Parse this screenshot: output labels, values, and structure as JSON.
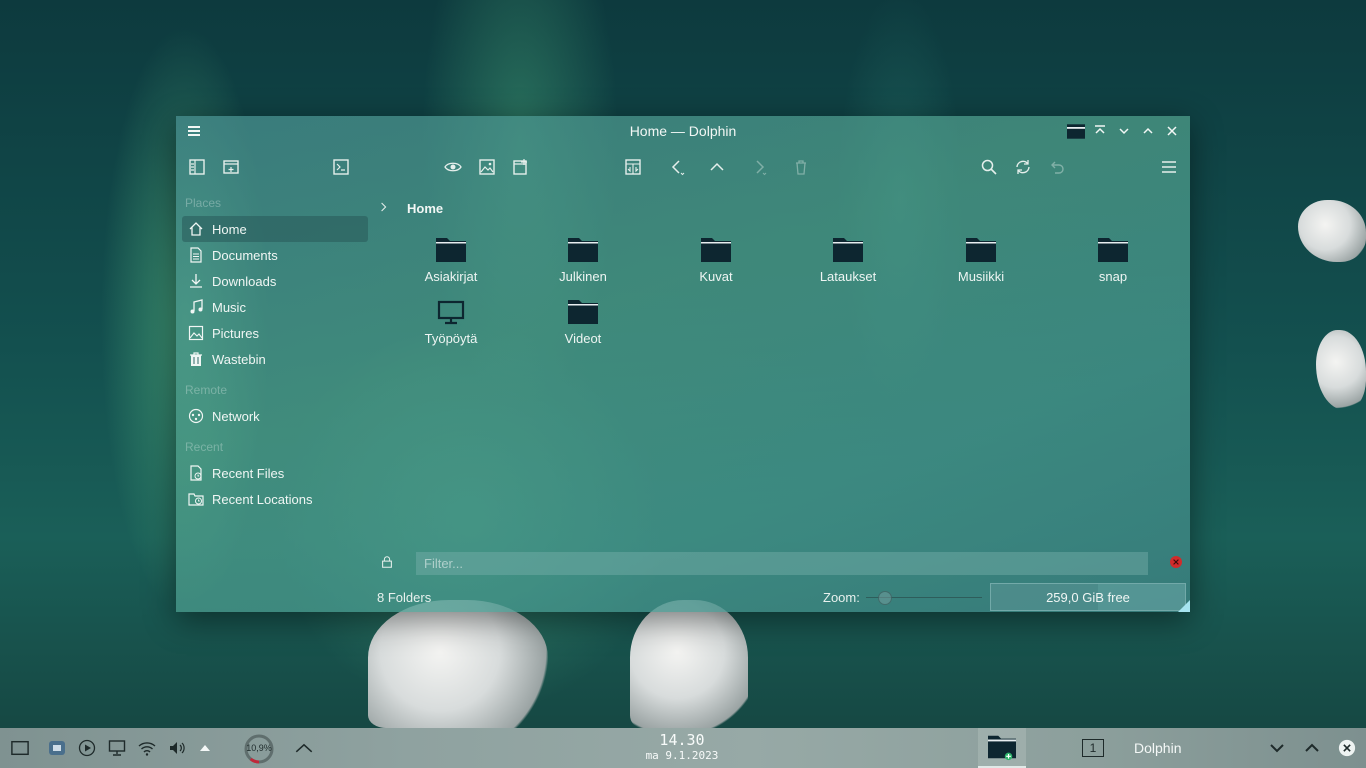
{
  "window": {
    "title": "Home — Dolphin"
  },
  "sidebar": {
    "sections": [
      {
        "header": "Places"
      },
      {
        "header": "Remote"
      },
      {
        "header": "Recent"
      }
    ],
    "places": [
      {
        "label": "Home",
        "icon": "home-icon",
        "selected": true
      },
      {
        "label": "Documents",
        "icon": "documents-icon"
      },
      {
        "label": "Downloads",
        "icon": "downloads-icon"
      },
      {
        "label": "Music",
        "icon": "music-icon"
      },
      {
        "label": "Pictures",
        "icon": "pictures-icon"
      },
      {
        "label": "Wastebin",
        "icon": "wastebin-icon"
      }
    ],
    "remote": [
      {
        "label": "Network",
        "icon": "network-icon"
      }
    ],
    "recent": [
      {
        "label": "Recent Files",
        "icon": "recent-files-icon"
      },
      {
        "label": "Recent Locations",
        "icon": "recent-locations-icon"
      }
    ]
  },
  "breadcrumb": {
    "current": "Home"
  },
  "files": [
    {
      "name": "Asiakirjat",
      "type": "folder"
    },
    {
      "name": "Julkinen",
      "type": "folder"
    },
    {
      "name": "Kuvat",
      "type": "folder"
    },
    {
      "name": "Lataukset",
      "type": "folder"
    },
    {
      "name": "Musiikki",
      "type": "folder"
    },
    {
      "name": "snap",
      "type": "folder"
    },
    {
      "name": "Työpöytä",
      "type": "desktop"
    },
    {
      "name": "Videot",
      "type": "folder"
    }
  ],
  "filter": {
    "placeholder": "Filter..."
  },
  "status": {
    "summary": "8 Folders",
    "zoom_label": "Zoom:",
    "free_space": "259,0 GiB free",
    "used_fraction": 0.55
  },
  "taskbar": {
    "cpu_label": "10,9%",
    "time": "14.30",
    "date": "ma 9.1.2023",
    "pager_number": "1",
    "active_task": "Dolphin"
  },
  "colors": {
    "close_filter": "#d22b2b",
    "selection": "#2f6a6a"
  }
}
